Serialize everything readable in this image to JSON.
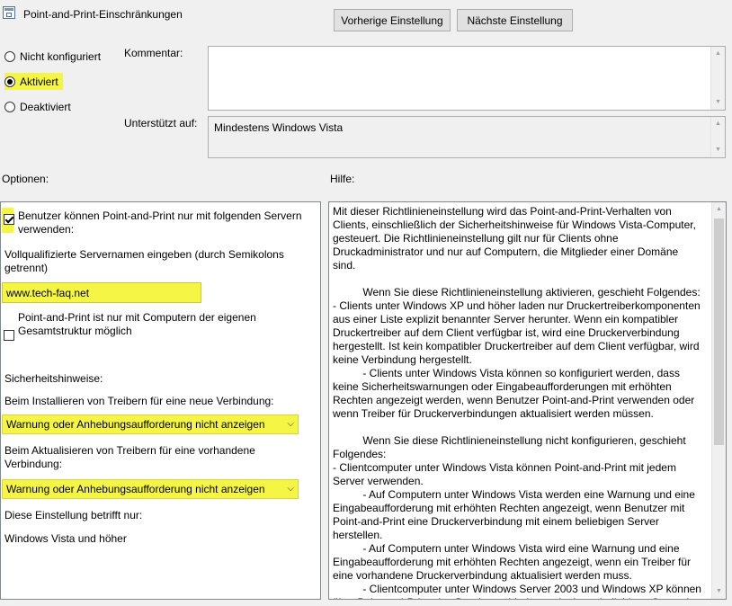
{
  "window": {
    "title": "Point-and-Print-Einschränkungen",
    "icon": "policy-settings-icon"
  },
  "nav": {
    "prev_label": "Vorherige Einstellung",
    "next_label": "Nächste Einstellung"
  },
  "state": {
    "options": [
      {
        "label": "Nicht konfiguriert",
        "checked": false
      },
      {
        "label": "Aktiviert",
        "checked": true
      },
      {
        "label": "Deaktiviert",
        "checked": false
      }
    ]
  },
  "comment": {
    "label": "Kommentar:",
    "value": ""
  },
  "supported": {
    "label": "Unterstützt auf:",
    "value": "Mindestens Windows Vista"
  },
  "options_label": "Optionen:",
  "help_label": "Hilfe:",
  "options_panel": {
    "checkbox1_label": "Benutzer können Point-and-Print nur mit folgenden Servern verwenden:",
    "checkbox1_checked": true,
    "servers_label": "Vollqualifizierte Servernamen eingeben (durch Semikolons getrennt)",
    "servers_value": "www.tech-faq.net",
    "checkbox2_label": "Point-and-Print ist nur mit Computern der eigenen Gesamtstruktur möglich",
    "checkbox2_checked": false,
    "security_label": "Sicherheitshinweise:",
    "install_label": "Beim Installieren von Treibern für eine neue Verbindung:",
    "install_value": "Warnung oder Anhebungsaufforderung nicht anzeigen",
    "update_label": "Beim Aktualisieren von Treibern für eine vorhandene Verbindung:",
    "update_value": "Warnung oder Anhebungsaufforderung nicht anzeigen",
    "applies_label": "Diese Einstellung betrifft nur:",
    "applies_value": "Windows Vista und höher"
  },
  "help": {
    "text": "Mit dieser Richtlinieneinstellung wird das Point-and-Print-Verhalten von Clients, einschließlich der Sicherheitshinweise für Windows Vista-Computer, gesteuert. Die Richtlinieneinstellung gilt nur für Clients ohne Druckadministrator und nur auf Computern, die Mitglieder einer Domäne sind.\n\n          Wenn Sie diese Richtlinieneinstellung aktivieren, geschieht Folgendes:\n- Clients unter Windows XP und höher laden nur Druckertreiberkomponenten aus einer Liste explizit benannter Server herunter. Wenn ein kompatibler Druckertreiber auf dem Client verfügbar ist, wird eine Druckerverbindung hergestellt. Ist kein kompatibler Druckertreiber auf dem Client verfügbar, wird keine Verbindung hergestellt.\n          - Clients unter Windows Vista können so konfiguriert werden, dass keine Sicherheitswarnungen oder Eingabeaufforderungen mit erhöhten Rechten angezeigt werden, wenn Benutzer Point-and-Print verwenden oder wenn Treiber für Druckerverbindungen aktualisiert werden müssen.\n\n          Wenn Sie diese Richtlinieneinstellung nicht konfigurieren, geschieht Folgendes:\n- Clientcomputer unter Windows Vista können Point-and-Print mit jedem Server verwenden.\n          - Auf Computern unter Windows Vista werden eine Warnung und eine Eingabeaufforderung mit erhöhten Rechten angezeigt, wenn Benutzer mit Point-and-Print eine Druckerverbindung mit einem beliebigen Server herstellen.\n          - Auf Computern unter Windows Vista wird eine Warnung und eine Eingabeaufforderung mit erhöhten Rechten angezeigt, wenn ein Treiber für eine vorhandene Druckerverbindung aktualisiert werden muss.\n          - Clientcomputer unter Windows Server 2003 und Windows XP können über Point-and-Print eine Druckerverbindung mit einem beliebigen Server in"
  },
  "colors": {
    "highlight": "#f5f545",
    "window_bg": "#f0f0f0"
  }
}
